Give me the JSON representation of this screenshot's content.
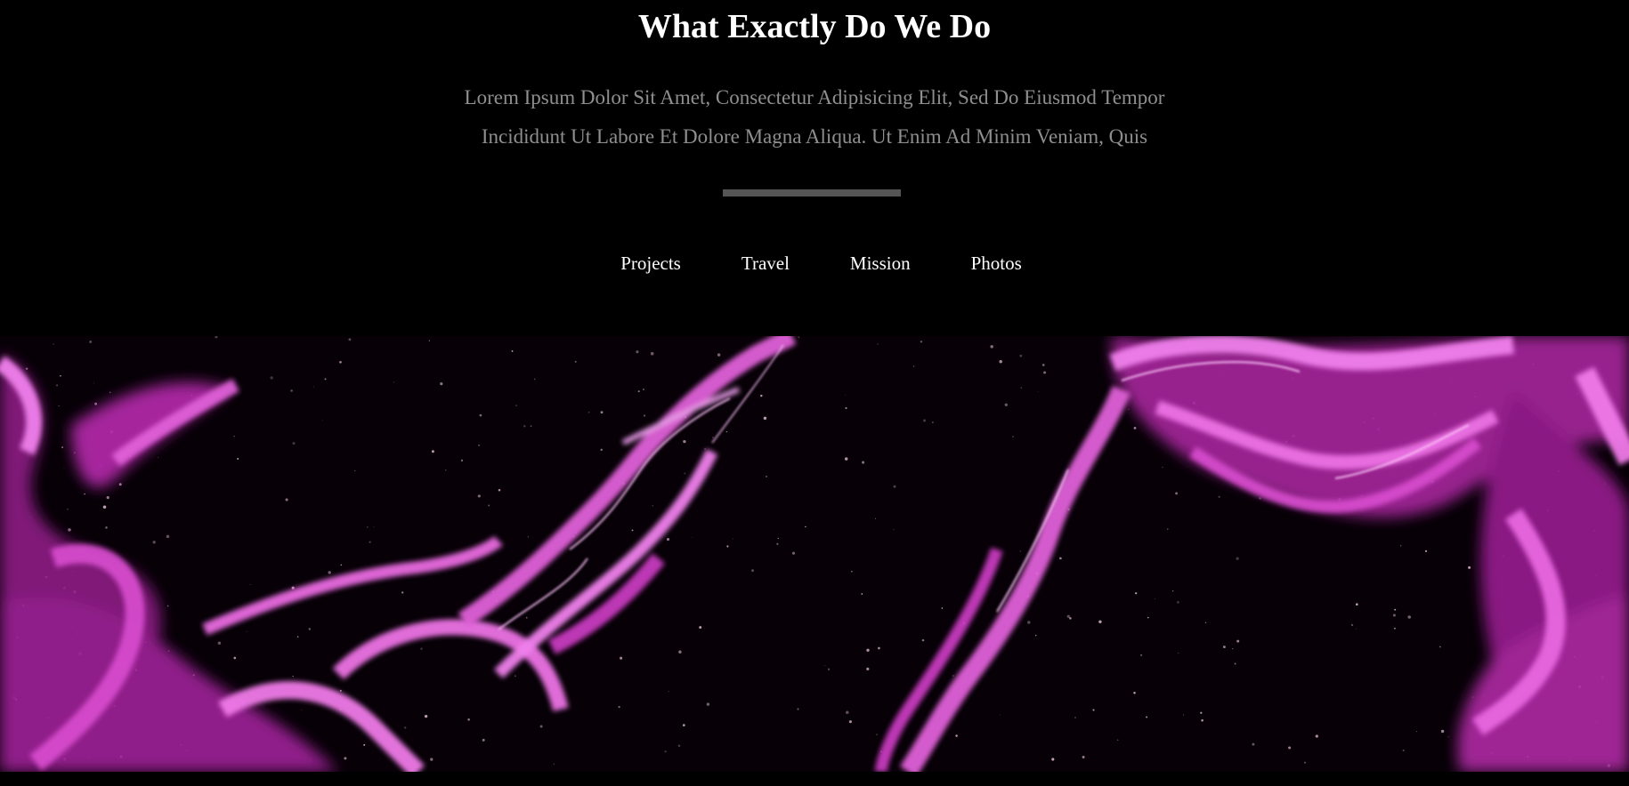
{
  "section": {
    "title": "What Exactly Do We Do",
    "intro_line1": "Lorem Ipsum Dolor Sit Amet, Consectetur Adipisicing Elit, Sed Do Eiusmod Tempor",
    "intro_line2": "Incididunt Ut Labore Et Dolore Magna Aliqua. Ut Enim Ad Minim Veniam, Quis"
  },
  "nav": {
    "items": [
      {
        "label": "Projects"
      },
      {
        "label": "Travel"
      },
      {
        "label": "Mission"
      },
      {
        "label": "Photos"
      }
    ]
  },
  "hero": {
    "image": "pink-smoke-on-starry-background",
    "accent_color": "#e040d0"
  },
  "colors": {
    "background": "#000000",
    "title": "#ffffff",
    "intro_text": "#8f8f8f",
    "divider": "#555555"
  }
}
